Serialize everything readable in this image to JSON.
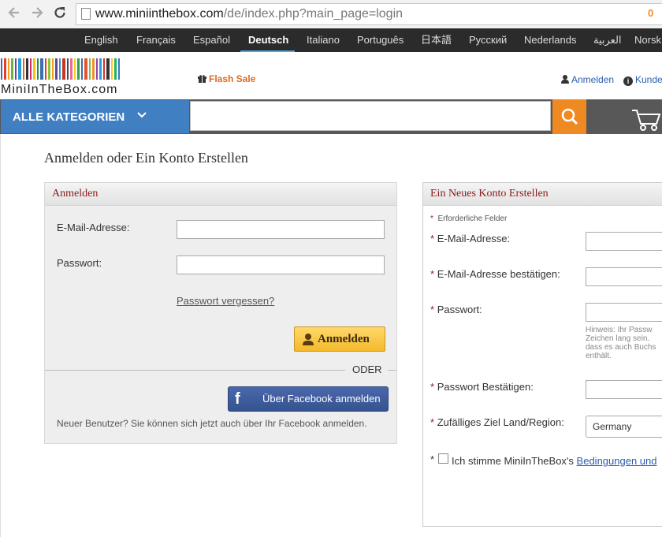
{
  "browser": {
    "url_domain": "www.miniinthebox.com",
    "url_path": "/de/index.php?main_page=login"
  },
  "languages": [
    "English",
    "Français",
    "Español",
    "Deutsch",
    "Italiano",
    "Português",
    "日本語",
    "Русский",
    "Nederlands",
    "العربية",
    "Norsk"
  ],
  "header": {
    "logo_text": "MiniInTheBox.com",
    "flash_sale": "Flash Sale",
    "login_link": "Anmelden",
    "service_link": "Kunde"
  },
  "searchbar": {
    "categories_label": "ALLE KATEGORIEN",
    "search_value": "",
    "cart_count": "0"
  },
  "page_title": "Anmelden oder Ein Konto Erstellen",
  "login": {
    "title": "Anmelden",
    "email_label": "E-Mail-Adresse:",
    "email_value": "",
    "password_label": "Passwort:",
    "password_value": "",
    "forgot": "Passwort vergessen?",
    "signin_button": "Anmelden",
    "or": "ODER",
    "facebook_button": "Über Facebook anmelden",
    "new_user_text": "Neuer Benutzer? Sie können sich jetzt auch über Ihr Facebook anmelden."
  },
  "register": {
    "title": "Ein Neues Konto Erstellen",
    "required_note": "Erforderliche Felder",
    "star": "*",
    "email_label": "E-Mail-Adresse:",
    "email_confirm_label": "E-Mail-Adresse bestätigen:",
    "password_label": "Passwort:",
    "hint_lines": [
      "Hinweis: Ihr Passw",
      "Zeichen lang sein.",
      "dass es auch Buchs",
      "enthält."
    ],
    "password_confirm_label": "Passwort Bestätigen:",
    "country_label": "Zufälliges Ziel Land/Region:",
    "country_value": "Germany",
    "terms_prefix": "Ich stimme MiniInTheBox's",
    "terms_link": "Bedingungen und"
  },
  "colors": {
    "lang_bar": "#2b2b2b",
    "category_blue": "#3f7fc2",
    "search_orange": "#ef8a23",
    "panel_title": "#8b1a1a",
    "facebook": "#3b5998",
    "signin_yellow": "#f4b92a"
  },
  "icons": [
    "back-arrow-icon",
    "forward-arrow-icon",
    "reload-icon",
    "page-icon",
    "gift-icon",
    "user-icon",
    "info-icon",
    "chevron-down-icon",
    "search-icon",
    "cart-icon",
    "facebook-icon"
  ]
}
